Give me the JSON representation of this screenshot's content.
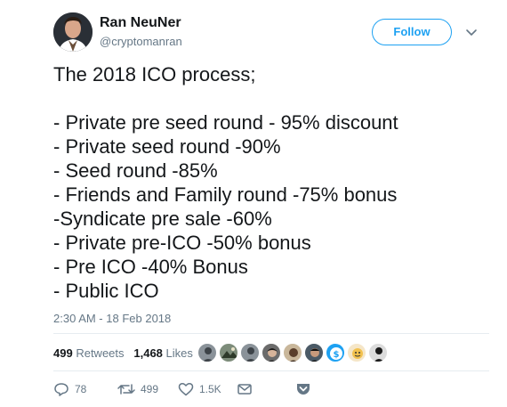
{
  "author": {
    "name": "Ran NeuNer",
    "handle": "@cryptomanran"
  },
  "follow_label": "Follow",
  "tweet_lines": [
    "The 2018 ICO process;",
    "",
    "- Private pre seed round - 95% discount",
    "- Private seed round -90%",
    "- Seed round -85%",
    "- Friends and Family round -75% bonus",
    "-Syndicate pre sale -60%",
    "- Private pre-ICO -50% bonus",
    "- Pre ICO -40% Bonus",
    "- Public ICO"
  ],
  "timestamp": "2:30 AM - 18 Feb 2018",
  "stats": {
    "retweets_count": "499",
    "retweets_label": "Retweets",
    "likes_count": "1,468",
    "likes_label": "Likes"
  },
  "actions": {
    "replies": "78",
    "retweets": "499",
    "likes": "1.5K"
  },
  "colors": {
    "accent": "#1da1f2",
    "secondary_text": "#657786",
    "primary_text": "#14171a"
  }
}
